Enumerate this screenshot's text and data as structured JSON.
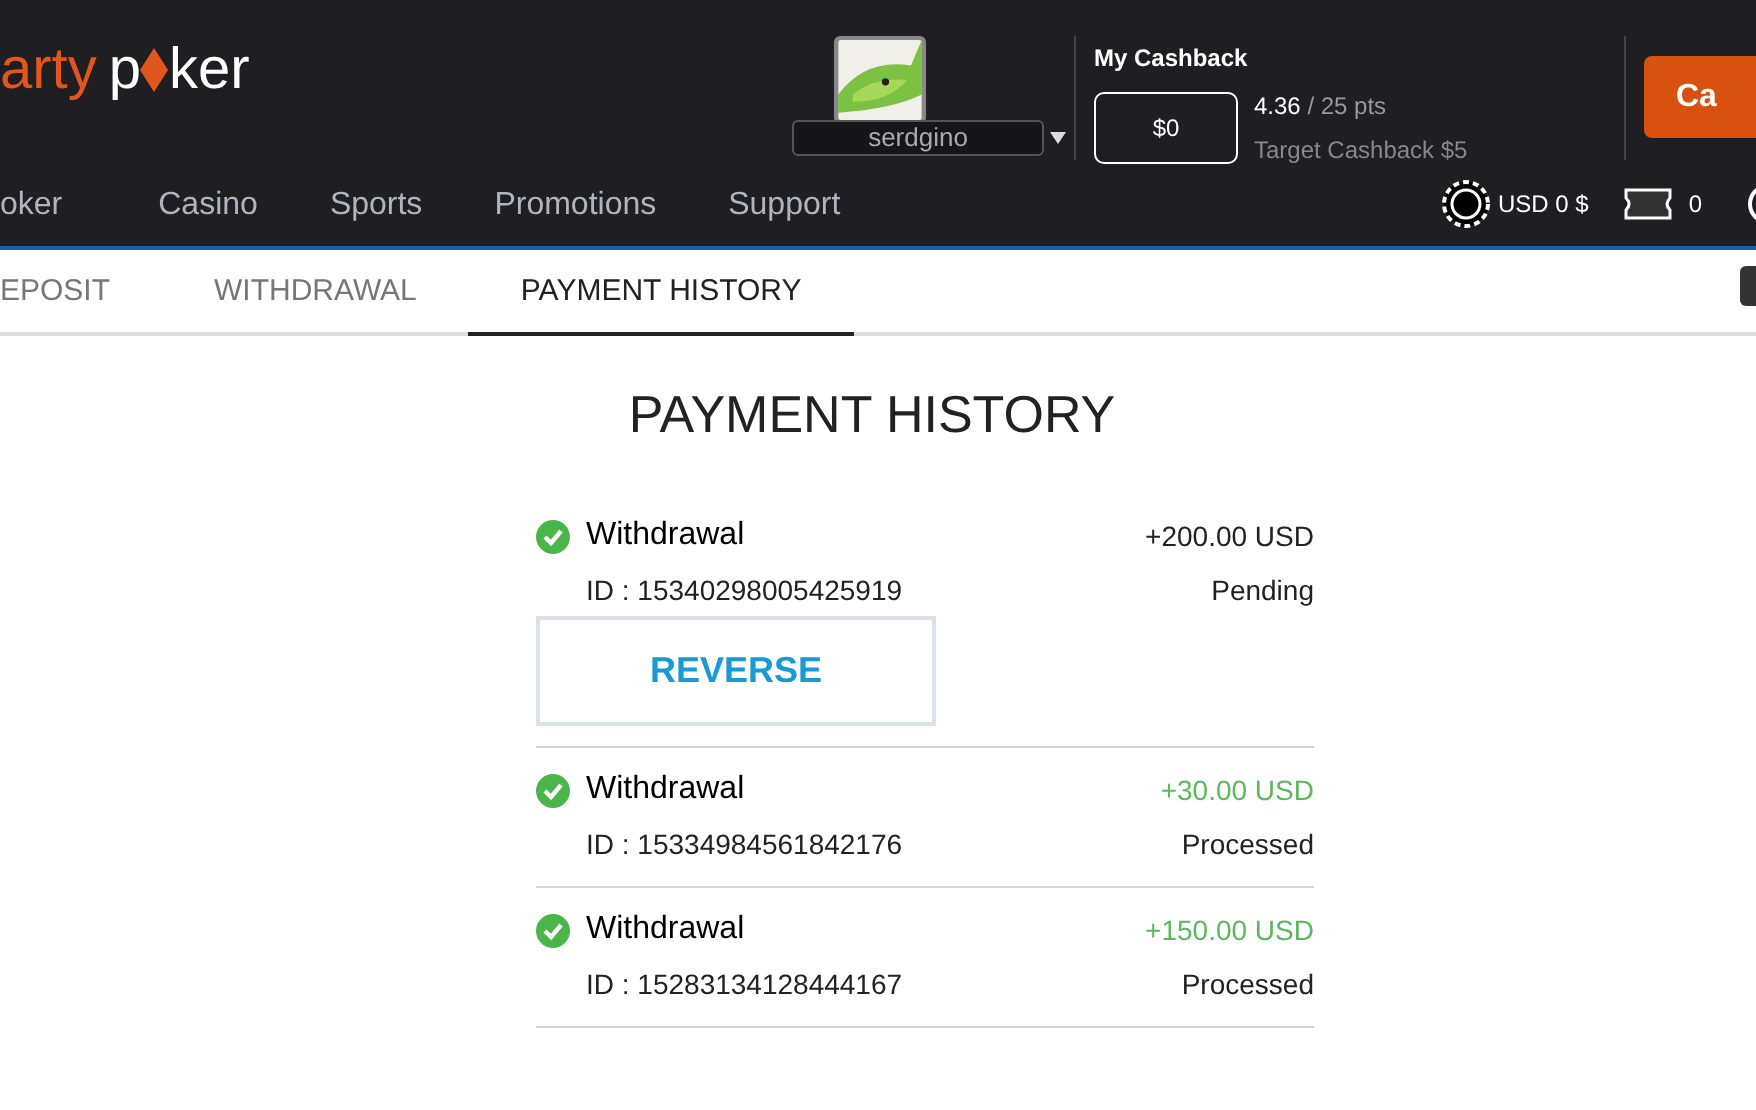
{
  "logo": {
    "first": "arty",
    "second": "p",
    "third": "ker"
  },
  "user": {
    "name": "serdgino"
  },
  "cashback": {
    "title": "My Cashback",
    "value": "$0",
    "points": "4.36",
    "points_total": "/ 25 pts",
    "target": "Target Cashback $5"
  },
  "cta_button": "Ca",
  "nav": [
    "oker",
    "Casino",
    "Sports",
    "Promotions",
    "Support"
  ],
  "balance": {
    "currency": "USD 0 $",
    "tickets": "0"
  },
  "tabs": [
    {
      "label": "EPOSIT",
      "selected": false
    },
    {
      "label": "WITHDRAWAL",
      "selected": false
    },
    {
      "label": "PAYMENT HISTORY",
      "selected": true
    }
  ],
  "title": "PAYMENT HISTORY",
  "payments": [
    {
      "type": "Withdrawal",
      "id": "ID : 15340298005425919",
      "amount": "+200.00 USD",
      "status": "Pending",
      "kind": "pending",
      "action": "REVERSE"
    },
    {
      "type": "Withdrawal",
      "id": "ID : 15334984561842176",
      "amount": "+30.00 USD",
      "status": "Processed",
      "kind": "processed"
    },
    {
      "type": "Withdrawal",
      "id": "ID : 15283134128444167",
      "amount": "+150.00 USD",
      "status": "Processed",
      "kind": "processed"
    }
  ]
}
